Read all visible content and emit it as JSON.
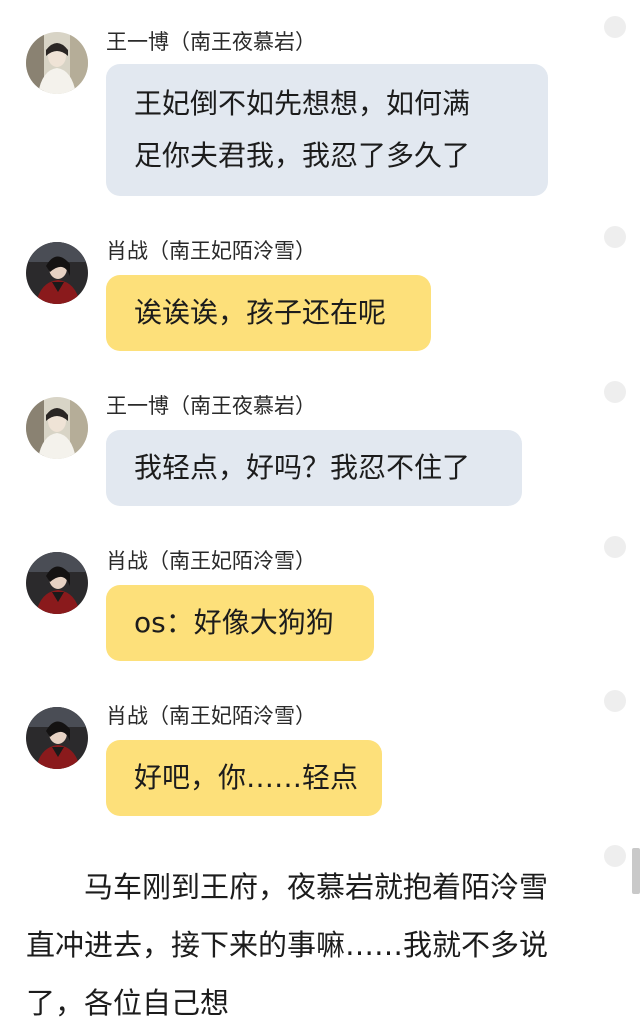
{
  "messages": [
    {
      "sender": "王一博（南王夜慕岩）",
      "lines": [
        "王妃倒不如先想想，如何满",
        "足你夫君我，我忍了多久了"
      ],
      "style": "blue",
      "avatar": "avatar-white-robe"
    },
    {
      "sender": "肖战（南王妃陌泠雪）",
      "lines": [
        "诶诶诶，孩子还在呢"
      ],
      "style": "yellow",
      "avatar": "avatar-red-robe"
    },
    {
      "sender": "王一博（南王夜慕岩）",
      "lines": [
        "我轻点，好吗？我忍不住了"
      ],
      "style": "blue",
      "avatar": "avatar-white-robe"
    },
    {
      "sender": "肖战（南王妃陌泠雪）",
      "lines": [
        "os：好像大狗狗"
      ],
      "style": "yellow",
      "avatar": "avatar-red-robe"
    },
    {
      "sender": "肖战（南王妃陌泠雪）",
      "lines": [
        "好吧，你……轻点"
      ],
      "style": "yellow",
      "avatar": "avatar-red-robe"
    }
  ],
  "narrative": {
    "lines": [
      "　　马车刚到王府，夜慕岩就抱着陌泠雪",
      "直冲进去，接下来的事嘛……我就不多说",
      "了，各位自己想"
    ]
  },
  "colors": {
    "bubble_blue": "#e2e8f0",
    "bubble_yellow": "#fde07a",
    "dot": "#eeeeee"
  }
}
